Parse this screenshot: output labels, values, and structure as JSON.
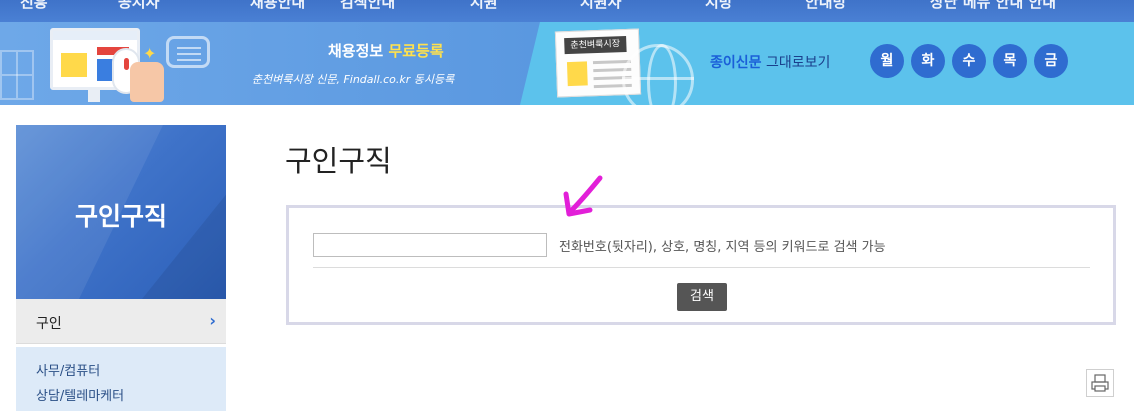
{
  "top_nav": {
    "items": [
      "진흥",
      "공지사",
      "채용안내",
      "검색안내",
      "지원",
      "지원사",
      "지방",
      "안내방",
      "상단 메뉴 안내 안내"
    ]
  },
  "banner": {
    "promo_title_prefix": "채용정보 ",
    "promo_title_highlight": "무료등록",
    "promo_subtitle": "춘천벼룩시장 신문, Findall.co.kr 동시등록",
    "paper_badge": "춘천벼룩시장",
    "paper_link_em": "종이신문",
    "paper_link_rest": " 그대로보기",
    "days": [
      "월",
      "화",
      "수",
      "목",
      "금"
    ]
  },
  "sidebar": {
    "title": "구인구직",
    "active_item": "구인",
    "active_chevron": "›",
    "sub_items": [
      "사무/컴퓨터",
      "상담/텔레마케터"
    ]
  },
  "main": {
    "page_title": "구인구직",
    "search": {
      "value": "",
      "placeholder": "",
      "hint": "전화번호(뒷자리), 상호, 명칭, 지역 등의 키워드로 검색 가능",
      "button_label": "검색"
    }
  },
  "colors": {
    "brand_blue": "#3f73c9",
    "banner_cyan": "#5cc2ec",
    "highlight_yellow": "#ffe14d",
    "annotation_arrow": "#e21fd8",
    "button_dark": "#555555"
  },
  "icons": {
    "print": "printer-icon",
    "chevron": "chevron-right-icon"
  }
}
